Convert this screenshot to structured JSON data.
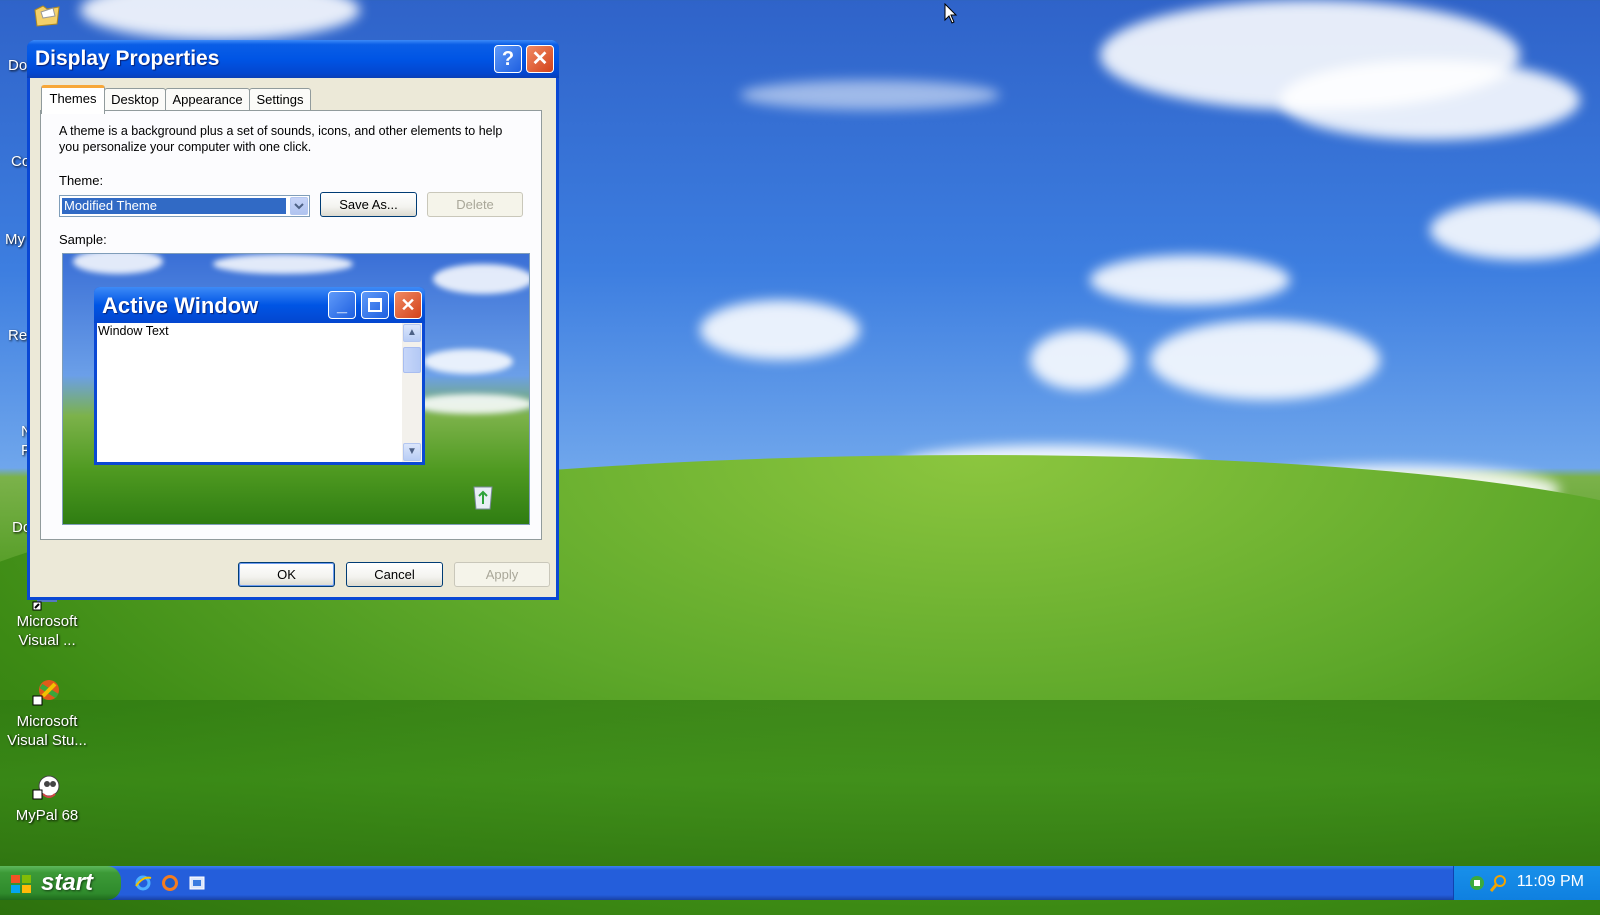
{
  "desktop": {
    "icons": [
      {
        "label_line1": "Microsoft",
        "label_line2": "Visual ..."
      },
      {
        "label_line1": "Microsoft",
        "label_line2": "Visual Stu..."
      },
      {
        "label_line1": "MyPal 68",
        "label_line2": ""
      }
    ],
    "partial_labels": [
      "Do",
      "Co",
      "My",
      "Re",
      "N",
      "F",
      "Do"
    ]
  },
  "dialog": {
    "title": "Display Properties",
    "tabs": [
      {
        "label": "Themes",
        "active": true
      },
      {
        "label": "Desktop",
        "active": false
      },
      {
        "label": "Appearance",
        "active": false
      },
      {
        "label": "Settings",
        "active": false
      }
    ],
    "description": "A theme is a background plus a set of sounds, icons, and other elements to help you personalize your computer with one click.",
    "theme_label": "Theme:",
    "theme_value": "Modified Theme",
    "save_as_label": "Save As...",
    "delete_label": "Delete",
    "sample_label": "Sample:",
    "sample": {
      "window_title": "Active Window",
      "window_text": "Window Text"
    },
    "ok_label": "OK",
    "cancel_label": "Cancel",
    "apply_label": "Apply"
  },
  "taskbar": {
    "start_label": "start",
    "clock": "11:09 PM"
  }
}
